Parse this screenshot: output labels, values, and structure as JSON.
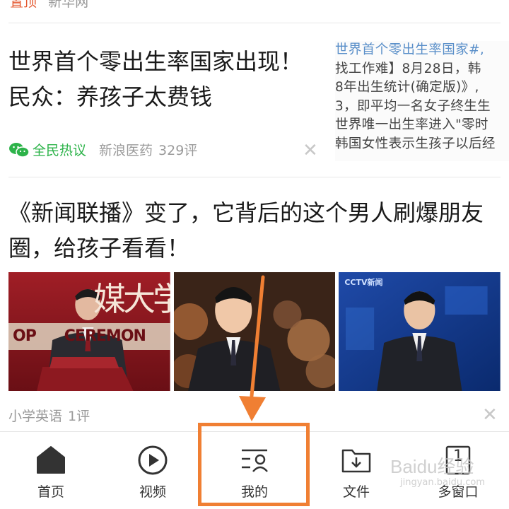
{
  "top_item": {
    "tag": "置顶",
    "source": "新华网"
  },
  "card1": {
    "title": "世界首个零出生率国家出现！民众：养孩子太费钱",
    "thumb_lines": [
      "世界首个零出生率国家#,",
      "找工作难】8月28日，韩",
      "8年出生统计(确定版)》,",
      "3，即平均一名女子终生生",
      "世界唯一出生率进入\"零时",
      "韩国女性表示生孩子以后经"
    ],
    "hot_label": "全民热议",
    "source": "新浪医药",
    "comments": "329评",
    "close_glyph": "✕"
  },
  "card2": {
    "title": "《新闻联播》变了，它背后的这个男人刷爆朋友圈，给孩子看看！",
    "photo1_text": "媒大学",
    "photo1_banner": "OP      CEREMON",
    "photo3_logo": "CCTV新闻",
    "source": "小学英语",
    "comments": "1评",
    "close_glyph": "✕"
  },
  "tabbar": {
    "tabs": [
      {
        "label": "首页",
        "icon": "home-icon"
      },
      {
        "label": "视频",
        "icon": "play-circle-icon"
      },
      {
        "label": "我的",
        "icon": "profile-list-icon"
      },
      {
        "label": "文件",
        "icon": "folder-download-icon"
      },
      {
        "label": "多窗口",
        "icon": "window-count-icon",
        "badge": "1"
      }
    ]
  },
  "watermark": {
    "main": "Baidu经验",
    "sub": "jingyan.baidu.com"
  },
  "colors": {
    "accent_annotation": "#f07f33",
    "hot_green": "#2db34a",
    "thumb_link": "#5a8fc9"
  }
}
